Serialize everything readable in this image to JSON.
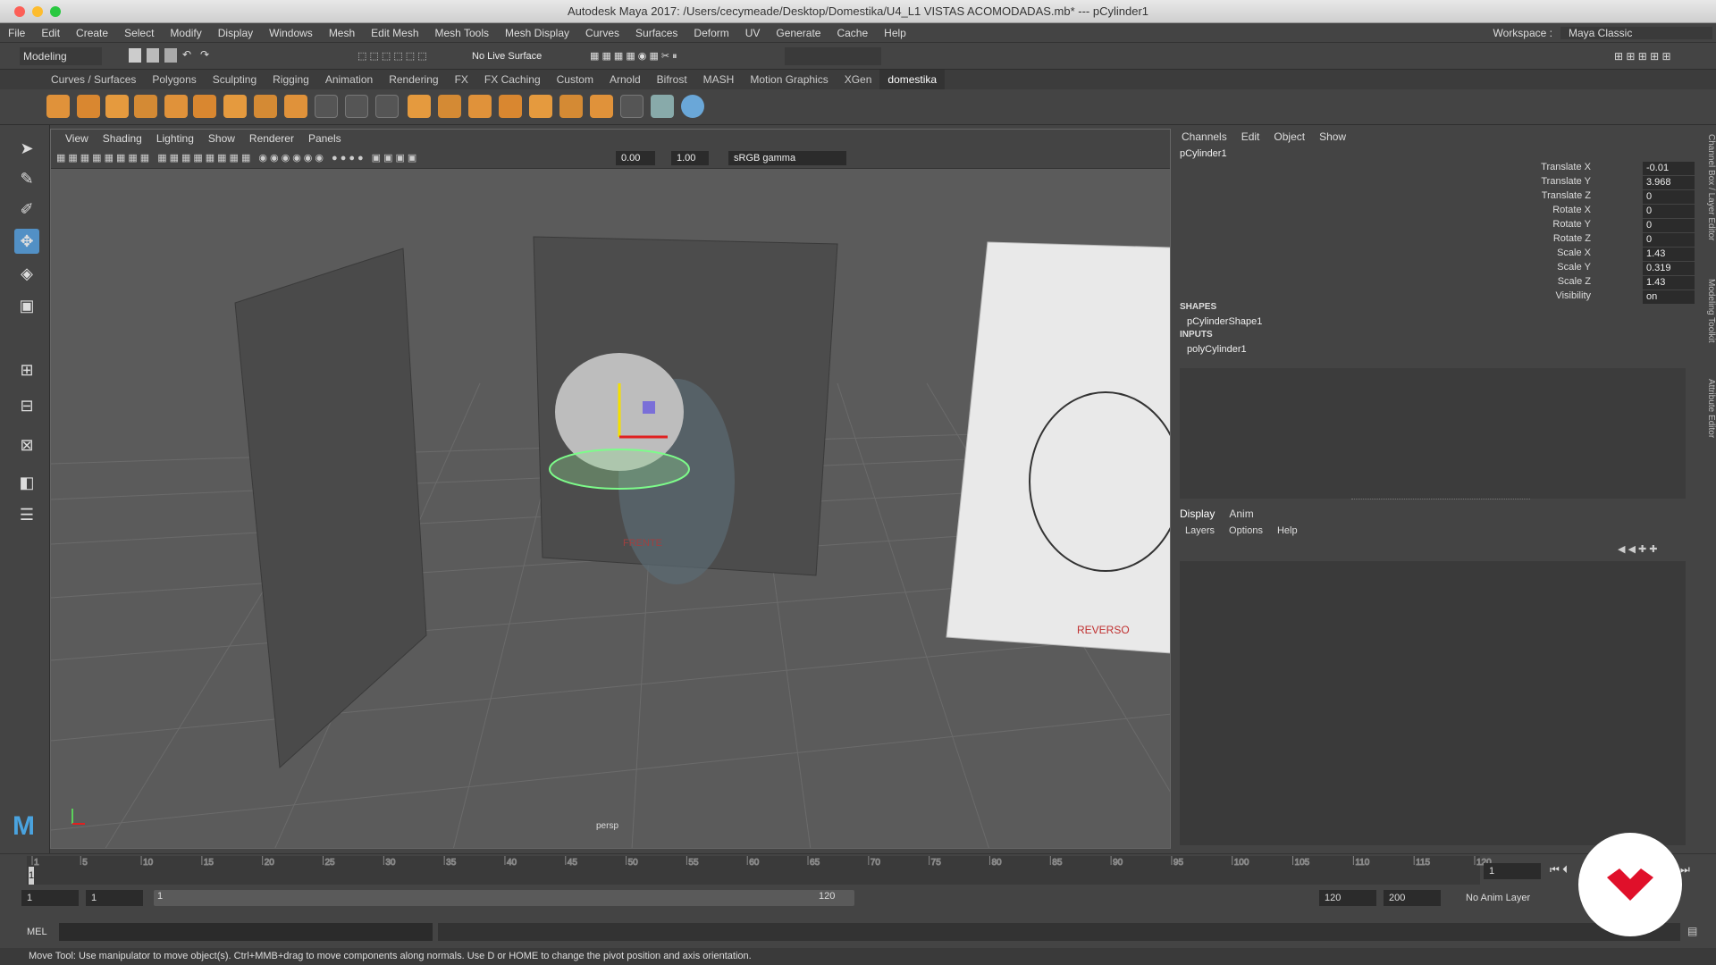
{
  "window": {
    "title": "Autodesk Maya 2017: /Users/cecymeade/Desktop/Domestika/U4_L1 VISTAS ACOMODADAS.mb*  ---  pCylinder1"
  },
  "menubar": [
    "File",
    "Edit",
    "Create",
    "Select",
    "Modify",
    "Display",
    "Windows",
    "Mesh",
    "Edit Mesh",
    "Mesh Tools",
    "Mesh Display",
    "Curves",
    "Surfaces",
    "Deform",
    "UV",
    "Generate",
    "Cache",
    "Help"
  ],
  "workspace": {
    "label": "Workspace :",
    "value": "Maya Classic"
  },
  "status": {
    "mode": "Modeling",
    "live_surface": "No Live Surface"
  },
  "shelf_tabs": [
    "Curves / Surfaces",
    "Polygons",
    "Sculpting",
    "Rigging",
    "Animation",
    "Rendering",
    "FX",
    "FX Caching",
    "Custom",
    "Arnold",
    "Bifrost",
    "MASH",
    "Motion Graphics",
    "XGen",
    "domestika"
  ],
  "shelf_active": "domestika",
  "viewport": {
    "menu": [
      "View",
      "Shading",
      "Lighting",
      "Show",
      "Renderer",
      "Panels"
    ],
    "exposure": "0.00",
    "gamma": "1.00",
    "colorspace": "sRGB gamma",
    "camera_label": "persp",
    "image_labels": {
      "front": "FRENTE",
      "back": "REVERSO"
    }
  },
  "channel_box": {
    "menu": [
      "Channels",
      "Edit",
      "Object",
      "Show"
    ],
    "object": "pCylinder1",
    "channels": [
      {
        "name": "Translate X",
        "value": "-0.01"
      },
      {
        "name": "Translate Y",
        "value": "3.968"
      },
      {
        "name": "Translate Z",
        "value": "0"
      },
      {
        "name": "Rotate X",
        "value": "0"
      },
      {
        "name": "Rotate Y",
        "value": "0"
      },
      {
        "name": "Rotate Z",
        "value": "0"
      },
      {
        "name": "Scale X",
        "value": "1.43"
      },
      {
        "name": "Scale Y",
        "value": "0.319"
      },
      {
        "name": "Scale Z",
        "value": "1.43"
      },
      {
        "name": "Visibility",
        "value": "on"
      }
    ],
    "shapes_header": "SHAPES",
    "shape": "pCylinderShape1",
    "inputs_header": "INPUTS",
    "input": "polyCylinder1"
  },
  "layer_editor": {
    "tabs": [
      "Display",
      "Anim"
    ],
    "menu": [
      "Layers",
      "Options",
      "Help"
    ]
  },
  "side_tabs": [
    "Channel Box / Layer Editor",
    "Modeling Toolkit",
    "Attribute Editor"
  ],
  "timeline": {
    "ticks": [
      "1",
      "5",
      "10",
      "15",
      "20",
      "25",
      "30",
      "35",
      "40",
      "45",
      "50",
      "55",
      "60",
      "65",
      "70",
      "75",
      "80",
      "85",
      "90",
      "95",
      "100",
      "105",
      "110",
      "115",
      "120"
    ],
    "current_frame": "1",
    "range_start": "1",
    "range_start_inner": "1",
    "slider_start": "1",
    "slider_end": "120",
    "range_end_inner": "120",
    "range_end": "200",
    "anim_layer": "No Anim Layer"
  },
  "command": {
    "label": "MEL"
  },
  "help_line": "Move Tool: Use manipulator to move object(s). Ctrl+MMB+drag to move components along normals. Use D or HOME to change the pivot position and axis orientation.",
  "colors": {
    "accent": "#4aa3df",
    "selected_wire": "#7dfc8a",
    "brand_red": "#e0102a"
  }
}
